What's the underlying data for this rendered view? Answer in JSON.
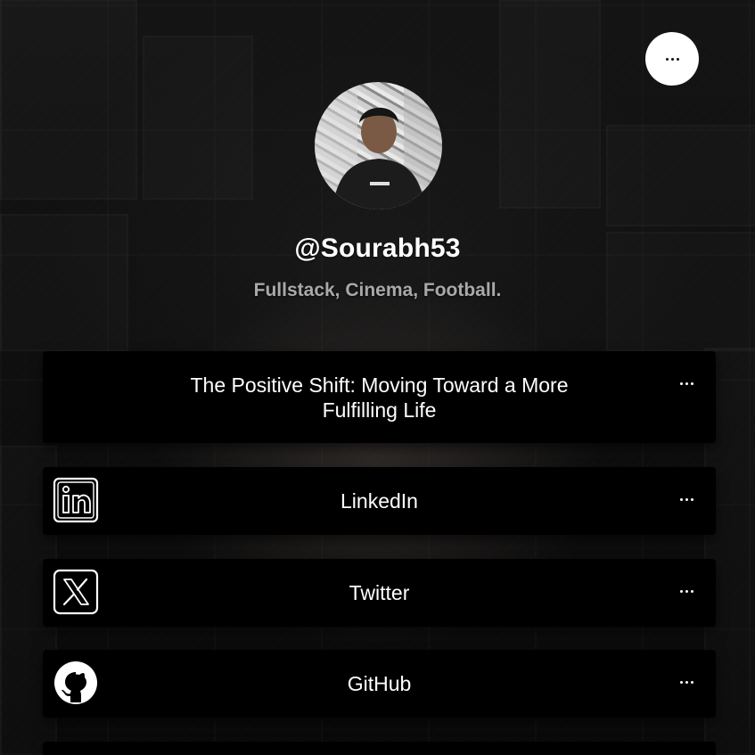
{
  "profile": {
    "username": "@Sourabh53",
    "bio": "Fullstack, Cinema, Football."
  },
  "header": {
    "menu_icon": "ellipsis-icon"
  },
  "links": [
    {
      "label": "The Positive Shift: Moving Toward a More Fulfilling Life",
      "icon": "none"
    },
    {
      "label": "LinkedIn",
      "icon": "linkedin-icon"
    },
    {
      "label": "Twitter",
      "icon": "x-icon"
    },
    {
      "label": "GitHub",
      "icon": "github-icon"
    }
  ],
  "colors": {
    "background": "#0b0b0b",
    "card": "#000000",
    "text": "#ffffff",
    "bio_text": "#a9a9a9",
    "menu_button": "#ffffff"
  }
}
